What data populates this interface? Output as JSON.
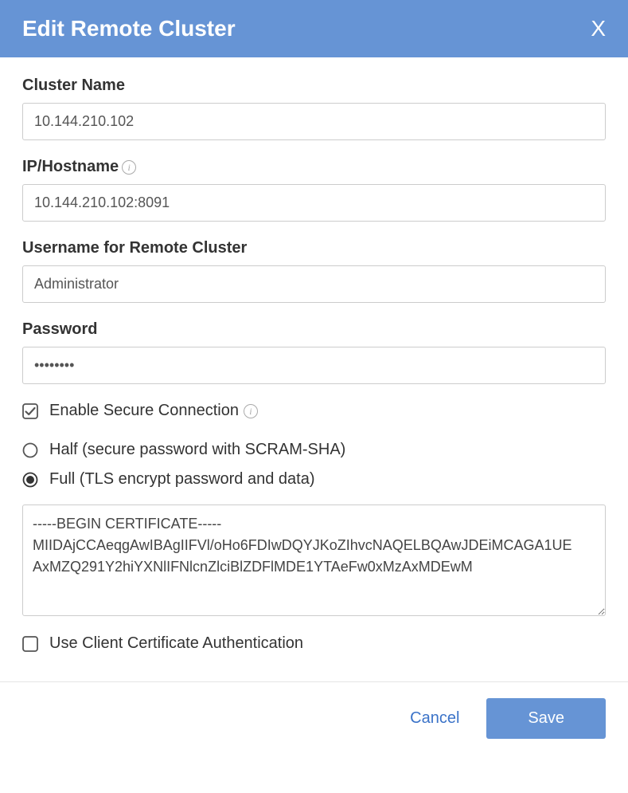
{
  "header": {
    "title": "Edit Remote Cluster",
    "close": "X"
  },
  "fields": {
    "clusterName": {
      "label": "Cluster Name",
      "value": "10.144.210.102"
    },
    "hostname": {
      "label": "IP/Hostname",
      "value": "10.144.210.102:8091"
    },
    "username": {
      "label": "Username for Remote Cluster",
      "value": "Administrator"
    },
    "password": {
      "label": "Password",
      "value": "••••••••"
    }
  },
  "secure": {
    "enableLabel": "Enable Secure Connection",
    "enabled": true,
    "mode": "full",
    "halfLabel": "Half (secure password with SCRAM-SHA)",
    "fullLabel": "Full (TLS encrypt password and data)",
    "certificate": "-----BEGIN CERTIFICATE-----\nMIIDAjCCAeqgAwIBAgIIFVl/oHo6FDIwDQYJKoZIhvcNAQELBQAwJDEiMCAGA1UE\nAxMZQ291Y2hiYXNlIFNlcnZlciBlZDFlMDE1YTAeFw0xMzAxMDEwM",
    "clientCertLabel": "Use Client Certificate Authentication",
    "clientCertEnabled": false
  },
  "footer": {
    "cancel": "Cancel",
    "save": "Save"
  }
}
